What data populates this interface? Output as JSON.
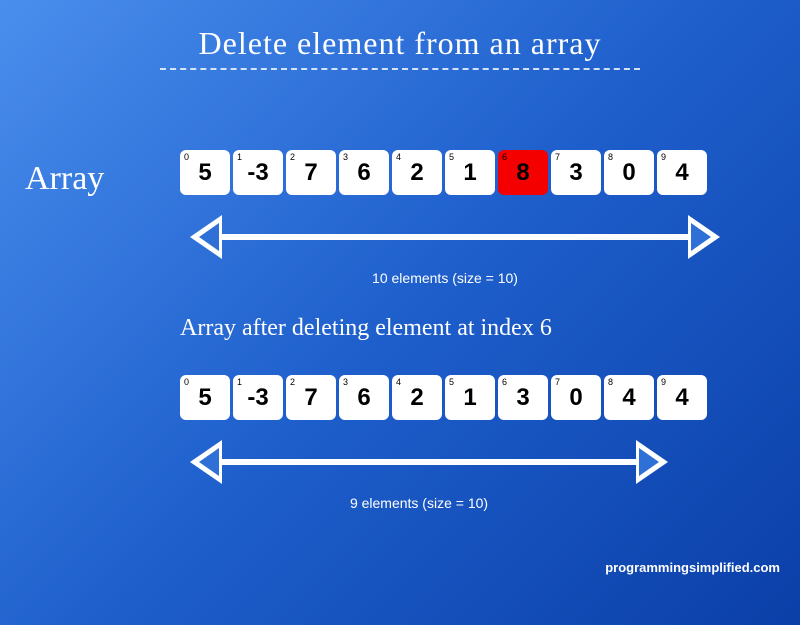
{
  "title": "Delete element from an array",
  "array_label": "Array",
  "array1": {
    "cells": [
      {
        "idx": "0",
        "val": "5",
        "highlight": false
      },
      {
        "idx": "1",
        "val": "-3",
        "highlight": false
      },
      {
        "idx": "2",
        "val": "7",
        "highlight": false
      },
      {
        "idx": "3",
        "val": "6",
        "highlight": false
      },
      {
        "idx": "4",
        "val": "2",
        "highlight": false
      },
      {
        "idx": "5",
        "val": "1",
        "highlight": false
      },
      {
        "idx": "6",
        "val": "8",
        "highlight": true
      },
      {
        "idx": "7",
        "val": "3",
        "highlight": false
      },
      {
        "idx": "8",
        "val": "0",
        "highlight": false
      },
      {
        "idx": "9",
        "val": "4",
        "highlight": false
      }
    ],
    "caption": "10 elements (size = 10)"
  },
  "subtitle": "Array after deleting element at index 6",
  "array2": {
    "cells": [
      {
        "idx": "0",
        "val": "5"
      },
      {
        "idx": "1",
        "val": "-3"
      },
      {
        "idx": "2",
        "val": "7"
      },
      {
        "idx": "3",
        "val": "6"
      },
      {
        "idx": "4",
        "val": "2"
      },
      {
        "idx": "5",
        "val": "1"
      },
      {
        "idx": "6",
        "val": "3"
      },
      {
        "idx": "7",
        "val": "0"
      },
      {
        "idx": "8",
        "val": "4"
      },
      {
        "idx": "9",
        "val": "4"
      }
    ],
    "caption": "9 elements (size = 10)"
  },
  "credit": "programmingsimplified.com"
}
